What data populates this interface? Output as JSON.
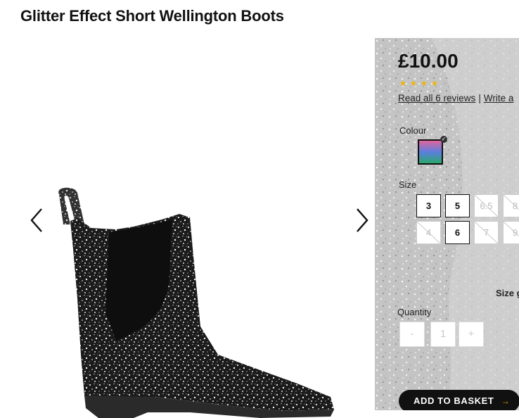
{
  "product": {
    "title": "Glitter Effect Short Wellington Boots"
  },
  "gallery": {
    "prev_icon": "chevron-left-icon",
    "next_icon": "chevron-right-icon"
  },
  "panel": {
    "price": "£10.00",
    "rating": {
      "stars": 4.5,
      "out_of": 5,
      "symbol": "★"
    },
    "reviews": {
      "read_label": "Read all 6 reviews",
      "separator": "|",
      "write_label": "Write a"
    },
    "colour": {
      "label": "Colour",
      "selected_icon": "check-icon",
      "swatch_colors": [
        "#e0659d",
        "#5b7fe0",
        "#2aa86a"
      ]
    },
    "size": {
      "label": "Size",
      "row1": [
        {
          "value": "3",
          "available": true
        },
        {
          "value": "5",
          "available": true
        },
        {
          "value": "6.5",
          "available": false
        },
        {
          "value": "8",
          "available": false
        }
      ],
      "row2": [
        {
          "value": "4",
          "available": false
        },
        {
          "value": "6",
          "available": true
        },
        {
          "value": "7",
          "available": false
        },
        {
          "value": "9",
          "available": false
        }
      ],
      "guide_label": "Size g"
    },
    "quantity": {
      "label": "Quantity",
      "minus": "-",
      "value": "1",
      "plus": "+"
    },
    "add_to_basket": {
      "label": "ADD TO BASKET",
      "arrow": "→",
      "accent": "#e6a800"
    }
  }
}
